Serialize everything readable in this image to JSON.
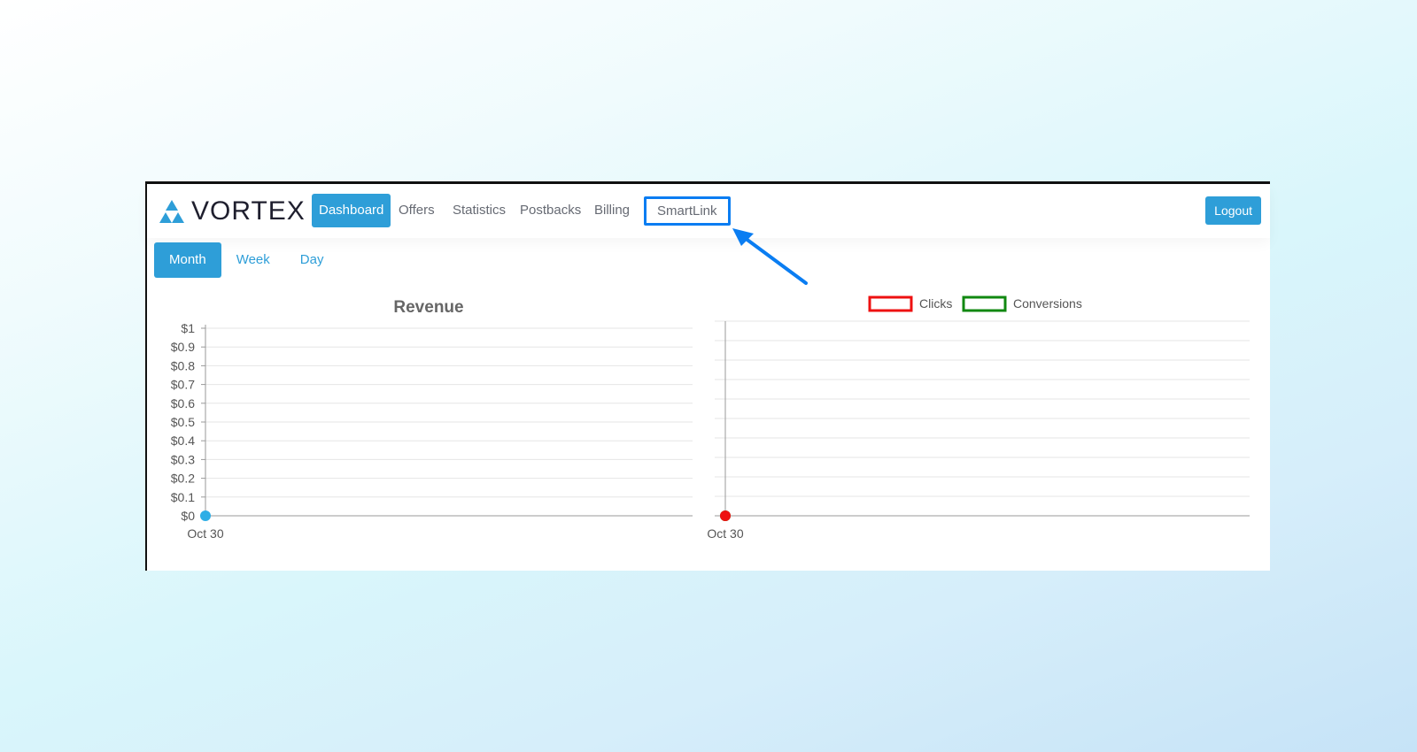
{
  "app": {
    "brand": "VORTEX",
    "colors": {
      "accent": "#2e9ed8",
      "highlight": "#0a7df2",
      "clicks": "#ee1111",
      "conversions": "#118811"
    }
  },
  "nav": {
    "items": [
      {
        "label": "Dashboard",
        "active": true
      },
      {
        "label": "Offers"
      },
      {
        "label": "Statistics"
      },
      {
        "label": "Postbacks"
      },
      {
        "label": "Billing"
      },
      {
        "label": "SmartLink",
        "highlighted": true
      }
    ],
    "logout_label": "Logout"
  },
  "period_tabs": [
    {
      "label": "Month",
      "active": true
    },
    {
      "label": "Week"
    },
    {
      "label": "Day"
    }
  ],
  "chart_data": [
    {
      "type": "line",
      "title": "Revenue",
      "categories": [
        "Oct 30"
      ],
      "series": [
        {
          "values": [
            0
          ],
          "color": "#2eaee6"
        }
      ],
      "ylim": [
        0,
        1
      ],
      "yticks": [
        "$0",
        "$0.1",
        "$0.2",
        "$0.3",
        "$0.4",
        "$0.5",
        "$0.6",
        "$0.7",
        "$0.8",
        "$0.9",
        "$1"
      ],
      "grid": true
    },
    {
      "type": "line",
      "title": "",
      "categories": [
        "Oct 30"
      ],
      "series": [
        {
          "name": "Clicks",
          "values": [
            0
          ],
          "color": "#ee1111"
        },
        {
          "name": "Conversions",
          "values": [
            0
          ],
          "color": "#118811"
        }
      ],
      "ylim": [
        0,
        10
      ],
      "grid": true,
      "legend": "top-center"
    }
  ]
}
